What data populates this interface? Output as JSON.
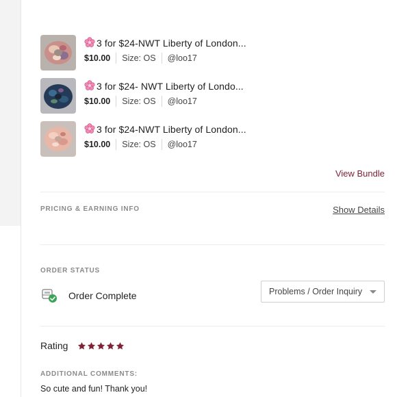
{
  "items": [
    {
      "title": "3 for $24-NWT Liberty of London...",
      "price": "$10.00",
      "size": "Size: OS",
      "seller": "@loo17",
      "flower_icon": "cherry-blossom-icon"
    },
    {
      "title": "3 for $24- NWT Liberty of Londo...",
      "price": "$10.00",
      "size": "Size: OS",
      "seller": "@loo17",
      "flower_icon": "cherry-blossom-icon"
    },
    {
      "title": "3 for $24-NWT Liberty of London...",
      "price": "$10.00",
      "size": "Size: OS",
      "seller": "@loo17",
      "flower_icon": "cherry-blossom-icon"
    }
  ],
  "bundle": {
    "view_label": "View Bundle"
  },
  "pricing": {
    "section_label": "PRICING & EARNING INFO",
    "show_details_label": "Show Details"
  },
  "order_status": {
    "section_label": "ORDER STATUS",
    "status_text": "Order Complete",
    "status_icon": "package-check-icon",
    "problems_button_label": "Problems / Order Inquiry"
  },
  "rating": {
    "label": "Rating",
    "stars": 5,
    "max_stars": 5
  },
  "comments": {
    "section_label": "ADDITIONAL COMMENTS:",
    "text": "So cute and fun! Thank you!"
  },
  "colors": {
    "accent": "#7f2234",
    "star": "#7f2234",
    "success": "#3aa655",
    "divider": "#ececec"
  }
}
